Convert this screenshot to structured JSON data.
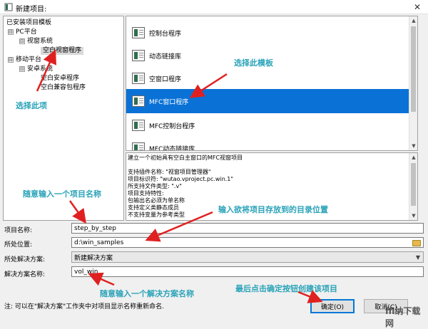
{
  "window": {
    "title": "新建项目:",
    "close_glyph": "✕"
  },
  "tree": {
    "header": "已安装项目模板",
    "items": [
      {
        "label": "PC平台",
        "expander": "⊟"
      },
      {
        "label": "视窗系统",
        "expander": "⊟"
      },
      {
        "label": "空白视窗程序",
        "expander": ""
      },
      {
        "label": "移动平台",
        "expander": "⊟"
      },
      {
        "label": "安卓系统",
        "expander": "⊟"
      },
      {
        "label": "空白安卓程序",
        "expander": ""
      },
      {
        "label": "空白兼容包程序",
        "expander": ""
      }
    ]
  },
  "templates": {
    "items": [
      {
        "label": "控制台程序"
      },
      {
        "label": "动态链接库"
      },
      {
        "label": "空窗口程序"
      },
      {
        "label": "MFC窗口程序",
        "selected": true
      },
      {
        "label": "MFC控制台程序"
      },
      {
        "label": "MFC动态链接库"
      }
    ]
  },
  "description": {
    "lines": [
      "建立一个初始具有空白主窗口的MFC视窗项目",
      "",
      "支持插件名称: \"视窗项目管理器\"",
      "项目标识符: \"wutao.vproject.pc.win.1\"",
      "所支持文件类型: \".v\"",
      "项目支持特性:",
      "    包输出名必须为单名称",
      "    支持定义类静态成员",
      "    不支持变量为参考类型"
    ]
  },
  "form": {
    "project_name_label": "项目名称:",
    "project_name_value": "step_by_step",
    "location_label": "所处位置:",
    "location_value": "d:\\win_samples",
    "solution_label": "所处解决方案:",
    "solution_value": "新建解决方案",
    "solution_name_label": "解决方案名称:",
    "solution_name_value": "vol_win"
  },
  "footer": {
    "note": "注: 可以在\"解决方案\"工作夹中对项目显示名称重新命名.",
    "ok_label": "确定(O)",
    "cancel_label": "取消(C)"
  },
  "annotations": {
    "select_item": "选择此项",
    "select_template": "选择此模板",
    "enter_project_name": "随意输入一个项目名称",
    "enter_location": "输入欲将项目存放到的目录位置",
    "enter_solution_name": "随意输入一个解决方案名称",
    "click_ok": "最后点击确定按钮创建该项目"
  },
  "watermark": "ffl纳下载网",
  "colors": {
    "selection": "#0a72d6",
    "annotation": "#2aa3b8",
    "arrow": "#e02020"
  }
}
